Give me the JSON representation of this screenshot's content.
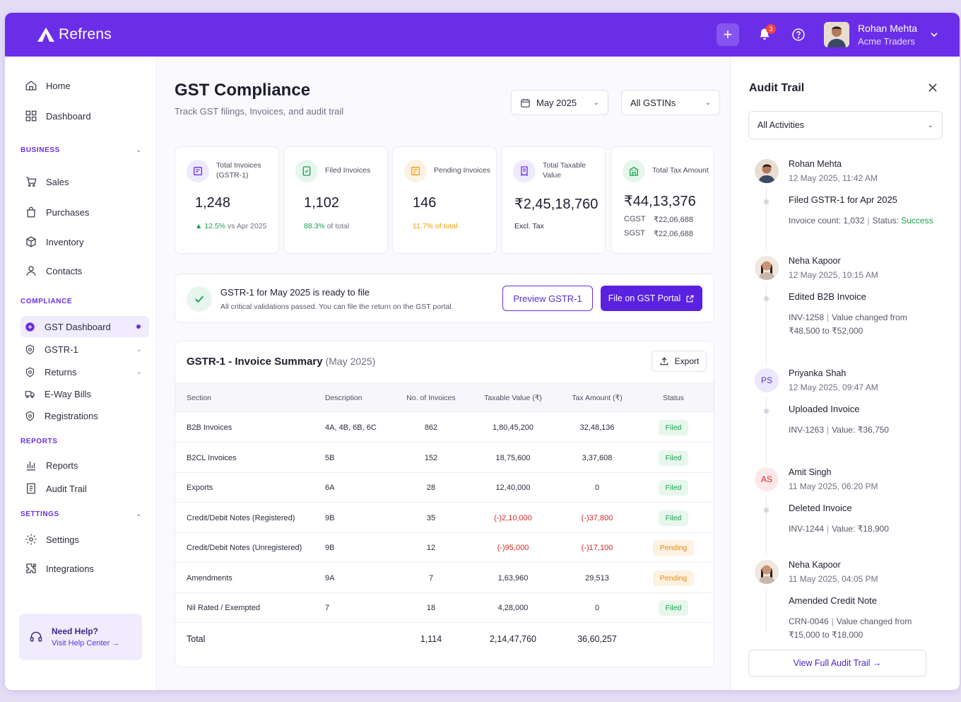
{
  "brand": {
    "name": "Refrens"
  },
  "topbar": {
    "notification_count": "3",
    "user_name": "Rohan Mehta",
    "user_org": "Acme Traders"
  },
  "sidebar": {
    "home": "Home",
    "dashboard": "Dashboard",
    "business_label": "BUSINESS",
    "sales": "Sales",
    "purchases": "Purchases",
    "inventory": "Inventory",
    "contacts": "Contacts",
    "compliance_label": "COMPLIANCE",
    "gst_dashboard": "GST Dashboard",
    "gstr1": "GSTR-1",
    "returns": "Returns",
    "eway": "E-Way Bills",
    "registrations": "Registrations",
    "reports_label": "REPORTS",
    "reports": "Reports",
    "audit_trail": "Audit Trail",
    "settings_label": "SETTINGS",
    "settings": "Settings",
    "integrations": "Integrations",
    "help_title": "Need Help?",
    "help_link": "Visit Help Center →"
  },
  "page": {
    "title": "GST Compliance",
    "subtitle": "Track GST filings, Invoices, and audit trail",
    "month_select": "May 2025",
    "gstin_select": "All GSTINs"
  },
  "stats": {
    "total_invoices": {
      "label": "Total Invoices (GSTR-1)",
      "value": "1,248",
      "foot_change": "▲ 12.5%",
      "foot_rest": " vs Apr 2025"
    },
    "filed_invoices": {
      "label": "Filed Invoices",
      "value": "1,102",
      "foot_pct": "88.3%",
      "foot_rest": " of total"
    },
    "pending_invoices": {
      "label": "Pending Invoices",
      "value": "146",
      "foot_pct": "11.7% of total"
    },
    "taxable_value": {
      "label": "Total Taxable Value",
      "value": "₹2,45,18,760",
      "foot": "Excl. Tax"
    },
    "tax_amount": {
      "label": "Total Tax Amount",
      "value": "₹44,13,376",
      "cgst_label": "CGST",
      "cgst_value": "₹22,06,688",
      "sgst_label": "SGST",
      "sgst_value": "₹22,06,688"
    }
  },
  "ready": {
    "title": "GSTR-1 for May 2025 is ready to file",
    "subtitle": "All critical validations passed. You can file the return on the GST portal.",
    "preview_btn": "Preview GSTR-1",
    "file_btn": "File on GST Portal"
  },
  "table": {
    "title": "GSTR-1 - Invoice Summary",
    "period": "(May 2025)",
    "export": "Export",
    "headers": {
      "section": "Section",
      "description": "Description",
      "count": "No. of Invoices",
      "taxable": "Taxable Value (₹)",
      "tax": "Tax Amount (₹)",
      "status": "Status"
    },
    "rows": [
      {
        "section": "B2B Invoices",
        "description": "4A, 4B, 6B, 6C",
        "count": "862",
        "taxable": "1,80,45,200",
        "tax": "32,48,136",
        "status": "Filed"
      },
      {
        "section": "B2CL Invoices",
        "description": "5B",
        "count": "152",
        "taxable": "18,75,600",
        "tax": "3,37,608",
        "status": "Filed"
      },
      {
        "section": "Exports",
        "description": "6A",
        "count": "28",
        "taxable": "12,40,000",
        "tax": "0",
        "status": "Filed"
      },
      {
        "section": "Credit/Debit Notes (Registered)",
        "description": "9B",
        "count": "35",
        "taxable": "(-)2,10,000",
        "tax": "(-)37,800",
        "status": "Filed"
      },
      {
        "section": "Credit/Debit Notes (Unregistered)",
        "description": "9B",
        "count": "12",
        "taxable": "(-)95,000",
        "tax": "(-)17,100",
        "status": "Pending"
      },
      {
        "section": "Amendments",
        "description": "9A",
        "count": "7",
        "taxable": "1,63,960",
        "tax": "29,513",
        "status": "Pending"
      },
      {
        "section": "Nil Rated / Exempted",
        "description": "7",
        "count": "18",
        "taxable": "4,28,000",
        "tax": "0",
        "status": "Filed"
      }
    ],
    "total": {
      "label": "Total",
      "count": "1,114",
      "taxable": "2,14,47,760",
      "tax": "36,60,257"
    }
  },
  "audit": {
    "title": "Audit Trail",
    "filter": "All Activities",
    "entries": [
      {
        "name": "Rohan Mehta",
        "time": "12 May 2025, 11:42 AM",
        "action": "Filed GSTR-1 for Apr 2025",
        "detail_a": "Invoice count: 1,032",
        "detail_b": "Status: ",
        "detail_status": "Success"
      },
      {
        "name": "Neha Kapoor",
        "time": "12 May 2025, 10:15 AM",
        "action": "Edited B2B Invoice",
        "detail_a": "INV-1258",
        "detail_b": "Value changed from",
        "detail_c": "₹48,500 to ₹52,000"
      },
      {
        "name": "Priyanka Shah",
        "initials": "PS",
        "time": "12 May 2025, 09:47 AM",
        "action": "Uploaded Invoice",
        "detail_a": "INV-1263",
        "detail_b": "Value: ₹36,750"
      },
      {
        "name": "Amit Singh",
        "initials": "AS",
        "time": "11 May 2025, 06:20 PM",
        "action": "Deleted Invoice",
        "detail_a": "INV-1244",
        "detail_b": "Value: ₹18,900"
      },
      {
        "name": "Neha Kapoor",
        "time": "11 May 2025, 04:05 PM",
        "action": "Amended Credit Note",
        "detail_a": "CRN-0046",
        "detail_b": "Value changed from",
        "detail_c": "₹15,000 to ₹18,000"
      }
    ],
    "view_full": "View Full Audit Trail  →"
  }
}
